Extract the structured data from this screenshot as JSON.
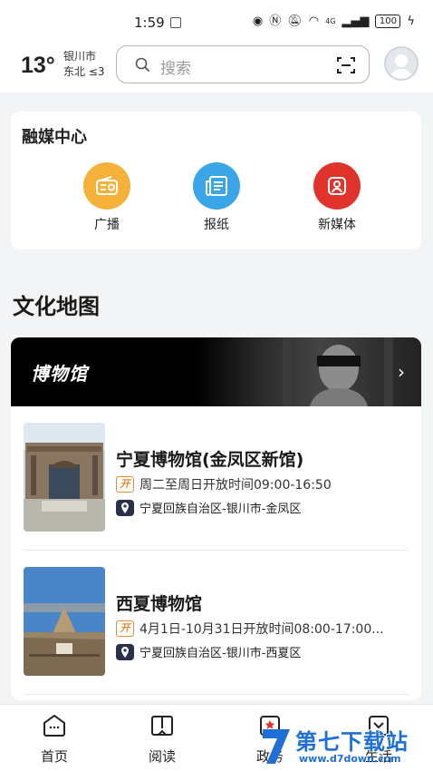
{
  "status_bar": {
    "time": "1:59",
    "network": "4G",
    "battery": "100"
  },
  "header": {
    "temperature": "13°",
    "city": "银川市",
    "wind": "东北 ≤3",
    "search_placeholder": "搜索"
  },
  "media_center": {
    "title": "融媒中心",
    "items": [
      {
        "label": "广播",
        "icon": "radio-icon",
        "color": "#f6b13a"
      },
      {
        "label": "报纸",
        "icon": "newspaper-icon",
        "color": "#3aa6e8"
      },
      {
        "label": "新媒体",
        "icon": "new-media-icon",
        "color": "#e0332c"
      }
    ]
  },
  "culture_map": {
    "title": "文化地图",
    "banner_title": "博物馆",
    "museums": [
      {
        "name": "宁夏博物馆(金凤区新馆)",
        "hours": "周二至周日开放时间09:00-16:50",
        "location": "宁夏回族自治区-银川市-金凤区"
      },
      {
        "name": "西夏博物馆",
        "hours": "4月1日-10月31日开放时间08:00-17:00...",
        "location": "宁夏回族自治区-银川市-西夏区"
      }
    ]
  },
  "tab_bar": {
    "items": [
      {
        "label": "首页",
        "icon": "home-icon"
      },
      {
        "label": "阅读",
        "icon": "book-icon"
      },
      {
        "label": "政务",
        "icon": "government-icon"
      },
      {
        "label": "生活",
        "icon": "life-icon"
      }
    ]
  },
  "watermark": {
    "text": "第七下载站",
    "url": "www.d7down.com"
  }
}
